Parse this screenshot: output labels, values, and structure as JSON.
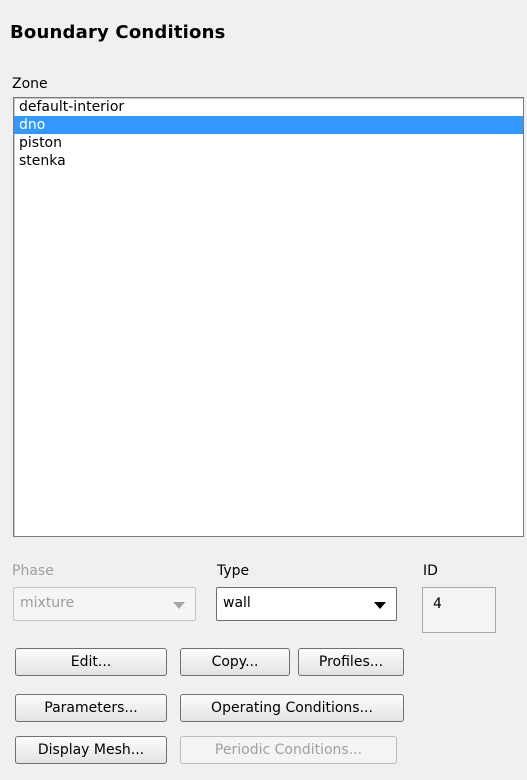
{
  "panel": {
    "title": "Boundary Conditions"
  },
  "zone": {
    "label": "Zone",
    "items": [
      "default-interior",
      "dno",
      "piston",
      "stenka"
    ],
    "selected": "dno"
  },
  "phase": {
    "label": "Phase",
    "value": "mixture"
  },
  "type": {
    "label": "Type",
    "value": "wall"
  },
  "id": {
    "label": "ID",
    "value": "4"
  },
  "buttons": {
    "edit": "Edit...",
    "copy": "Copy...",
    "profiles": "Profiles...",
    "parameters": "Parameters...",
    "operating_conditions": "Operating Conditions...",
    "display_mesh": "Display Mesh...",
    "periodic_conditions": "Periodic Conditions..."
  },
  "colors": {
    "selection": "#3399ff"
  }
}
